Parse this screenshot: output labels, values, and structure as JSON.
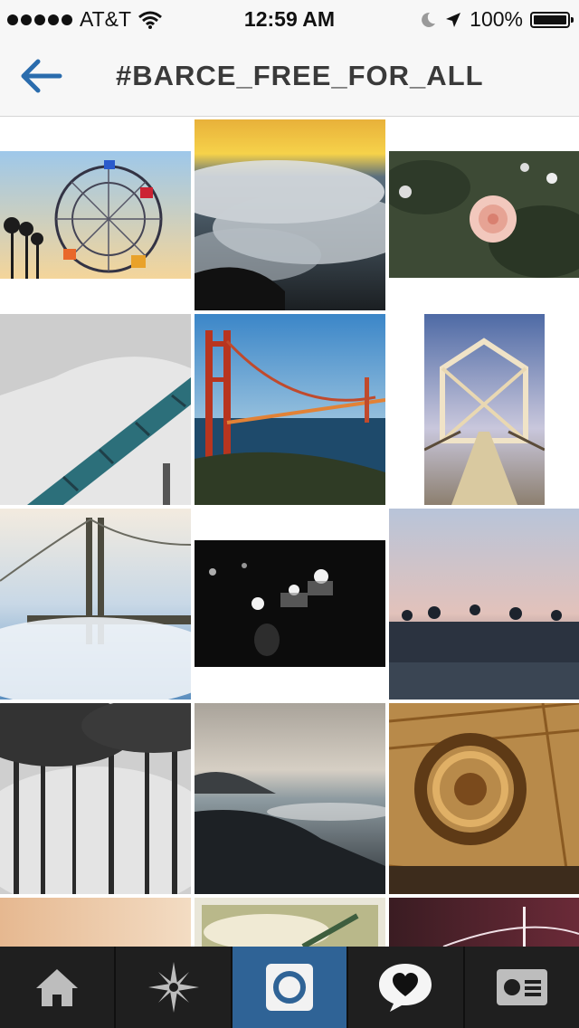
{
  "status_bar": {
    "carrier": "AT&T",
    "time": "12:59 AM",
    "battery": "100%",
    "signal_dots": 5
  },
  "nav": {
    "title": "#BARCE_FREE_FOR_ALL",
    "back_icon": "back-arrow-icon"
  },
  "grid": {
    "photos": [
      {
        "name": "photo-ferris-wheel"
      },
      {
        "name": "photo-sunset-fog"
      },
      {
        "name": "photo-dahlia-flower"
      },
      {
        "name": "photo-rollercoaster-track"
      },
      {
        "name": "photo-golden-gate-bridge"
      },
      {
        "name": "photo-rope-bridge"
      },
      {
        "name": "photo-bay-bridge-fog"
      },
      {
        "name": "photo-candles"
      },
      {
        "name": "photo-palm-skyline-dusk"
      },
      {
        "name": "photo-misty-trees"
      },
      {
        "name": "photo-rocky-coast"
      },
      {
        "name": "photo-hotel-atrium-sculpture"
      },
      {
        "name": "photo-beige-partial"
      },
      {
        "name": "photo-bridge-sky-partial"
      },
      {
        "name": "photo-bay-bridge-night-partial"
      }
    ]
  },
  "tabbar": {
    "tabs": [
      {
        "icon": "home-icon",
        "active": false
      },
      {
        "icon": "explore-star-icon",
        "active": true
      },
      {
        "icon": "camera-icon",
        "active": true
      },
      {
        "icon": "activity-heart-icon",
        "active": false
      },
      {
        "icon": "profile-card-icon",
        "active": false
      }
    ]
  },
  "colors": {
    "accent": "#2f6396",
    "back_arrow": "#2a6cad",
    "tab_bg": "#1f1f1f"
  }
}
